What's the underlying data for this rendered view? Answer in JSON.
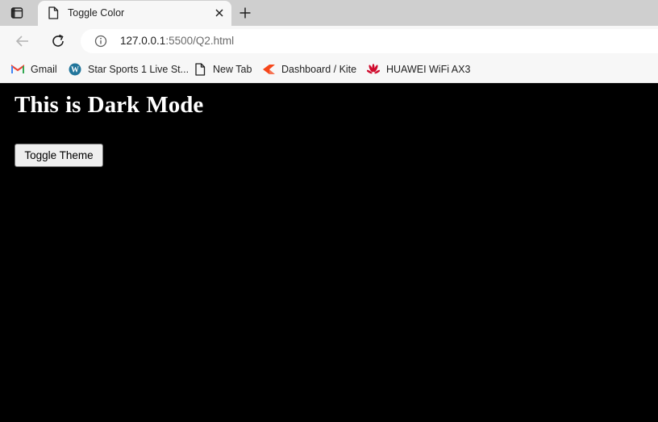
{
  "tab": {
    "title": "Toggle Color"
  },
  "omnibox": {
    "url_host": "127.0.0.1",
    "url_rest": ":5500/Q2.html"
  },
  "bookmarks": [
    {
      "label": "Gmail",
      "icon": "gmail-icon"
    },
    {
      "label": "Star Sports 1 Live St...",
      "icon": "wordpress-icon"
    },
    {
      "label": "New Tab",
      "icon": "page-icon"
    },
    {
      "label": "Dashboard / Kite",
      "icon": "kite-icon"
    },
    {
      "label": "HUAWEI WiFi AX3",
      "icon": "huawei-icon"
    }
  ],
  "page": {
    "heading": "This is Dark Mode",
    "button_label": "Toggle Theme",
    "background_color": "#000000",
    "text_color": "#ffffff"
  }
}
